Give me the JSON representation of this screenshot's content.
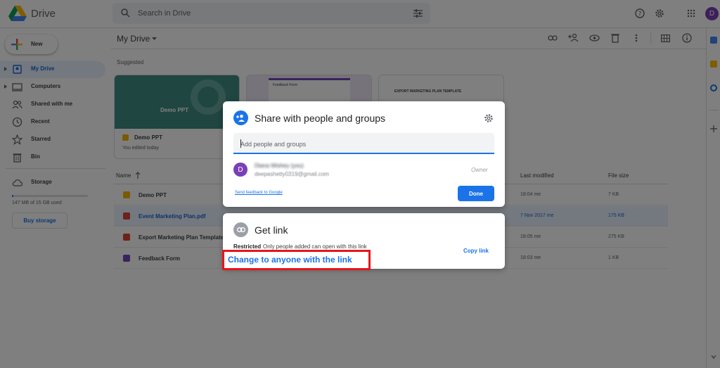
{
  "app": {
    "title": "Drive"
  },
  "search": {
    "placeholder": "Search in Drive"
  },
  "user": {
    "avatar_letter": "D"
  },
  "sidebar": {
    "new_label": "New",
    "items": [
      {
        "label": "My Drive",
        "icon": "drive-icon",
        "active": true
      },
      {
        "label": "Computers",
        "icon": "computer-icon"
      },
      {
        "label": "Shared with me",
        "icon": "people-icon"
      },
      {
        "label": "Recent",
        "icon": "clock-icon"
      },
      {
        "label": "Starred",
        "icon": "star-icon"
      },
      {
        "label": "Bin",
        "icon": "trash-icon"
      },
      {
        "label": "Storage",
        "icon": "cloud-icon"
      }
    ],
    "storage_text": "147 MB of 15 GB used",
    "storage_fraction": 0.01,
    "buy_storage_label": "Buy storage"
  },
  "main": {
    "title": "My Drive",
    "suggested_label": "Suggested",
    "cards": [
      {
        "name": "Demo PPT",
        "thumb_text": "Demo PPT",
        "subtitle": "You edited today"
      },
      {
        "name": "Feedback Form",
        "thumb_text": "Feedback Form"
      },
      {
        "name": "Export Marketing Plan Template",
        "thumb_text": "EXPORT MARKETING PLAN TEMPLATE"
      }
    ],
    "columns": {
      "name": "Name",
      "modified": "Last modified",
      "size": "File size"
    },
    "files": [
      {
        "name": "Demo PPT",
        "modified": "18:04 me",
        "size": "7 KB",
        "type": "slides",
        "color": "#f4b400"
      },
      {
        "name": "Event Marketing Plan.pdf",
        "modified": "7 Nov 2017 me",
        "size": "175 KB",
        "type": "pdf",
        "color": "#db4437",
        "selected": true
      },
      {
        "name": "Export Marketing Plan Template.",
        "modified": "18:05 me",
        "size": "275 KB",
        "type": "pdf",
        "color": "#db4437"
      },
      {
        "name": "Feedback Form",
        "modified": "18:03 me",
        "size": "1 KB",
        "type": "forms",
        "color": "#7248b9"
      }
    ]
  },
  "share_dialog": {
    "title": "Share with people and groups",
    "input_placeholder": "Add people and groups",
    "person": {
      "name": "Diana Wishey (you)",
      "email": "deepashetty0319@gmail.com",
      "role": "Owner",
      "avatar": "D"
    },
    "feedback_link": "Send feedback to Google",
    "done_label": "Done"
  },
  "get_link_dialog": {
    "title": "Get link",
    "restricted_label": "Restricted",
    "restricted_desc": "Only people added can open with this link",
    "copy_link_label": "Copy link",
    "change_link_label": "Change to anyone with the link"
  },
  "colors": {
    "accent": "#1a73e8",
    "highlight": "#e8141b"
  }
}
